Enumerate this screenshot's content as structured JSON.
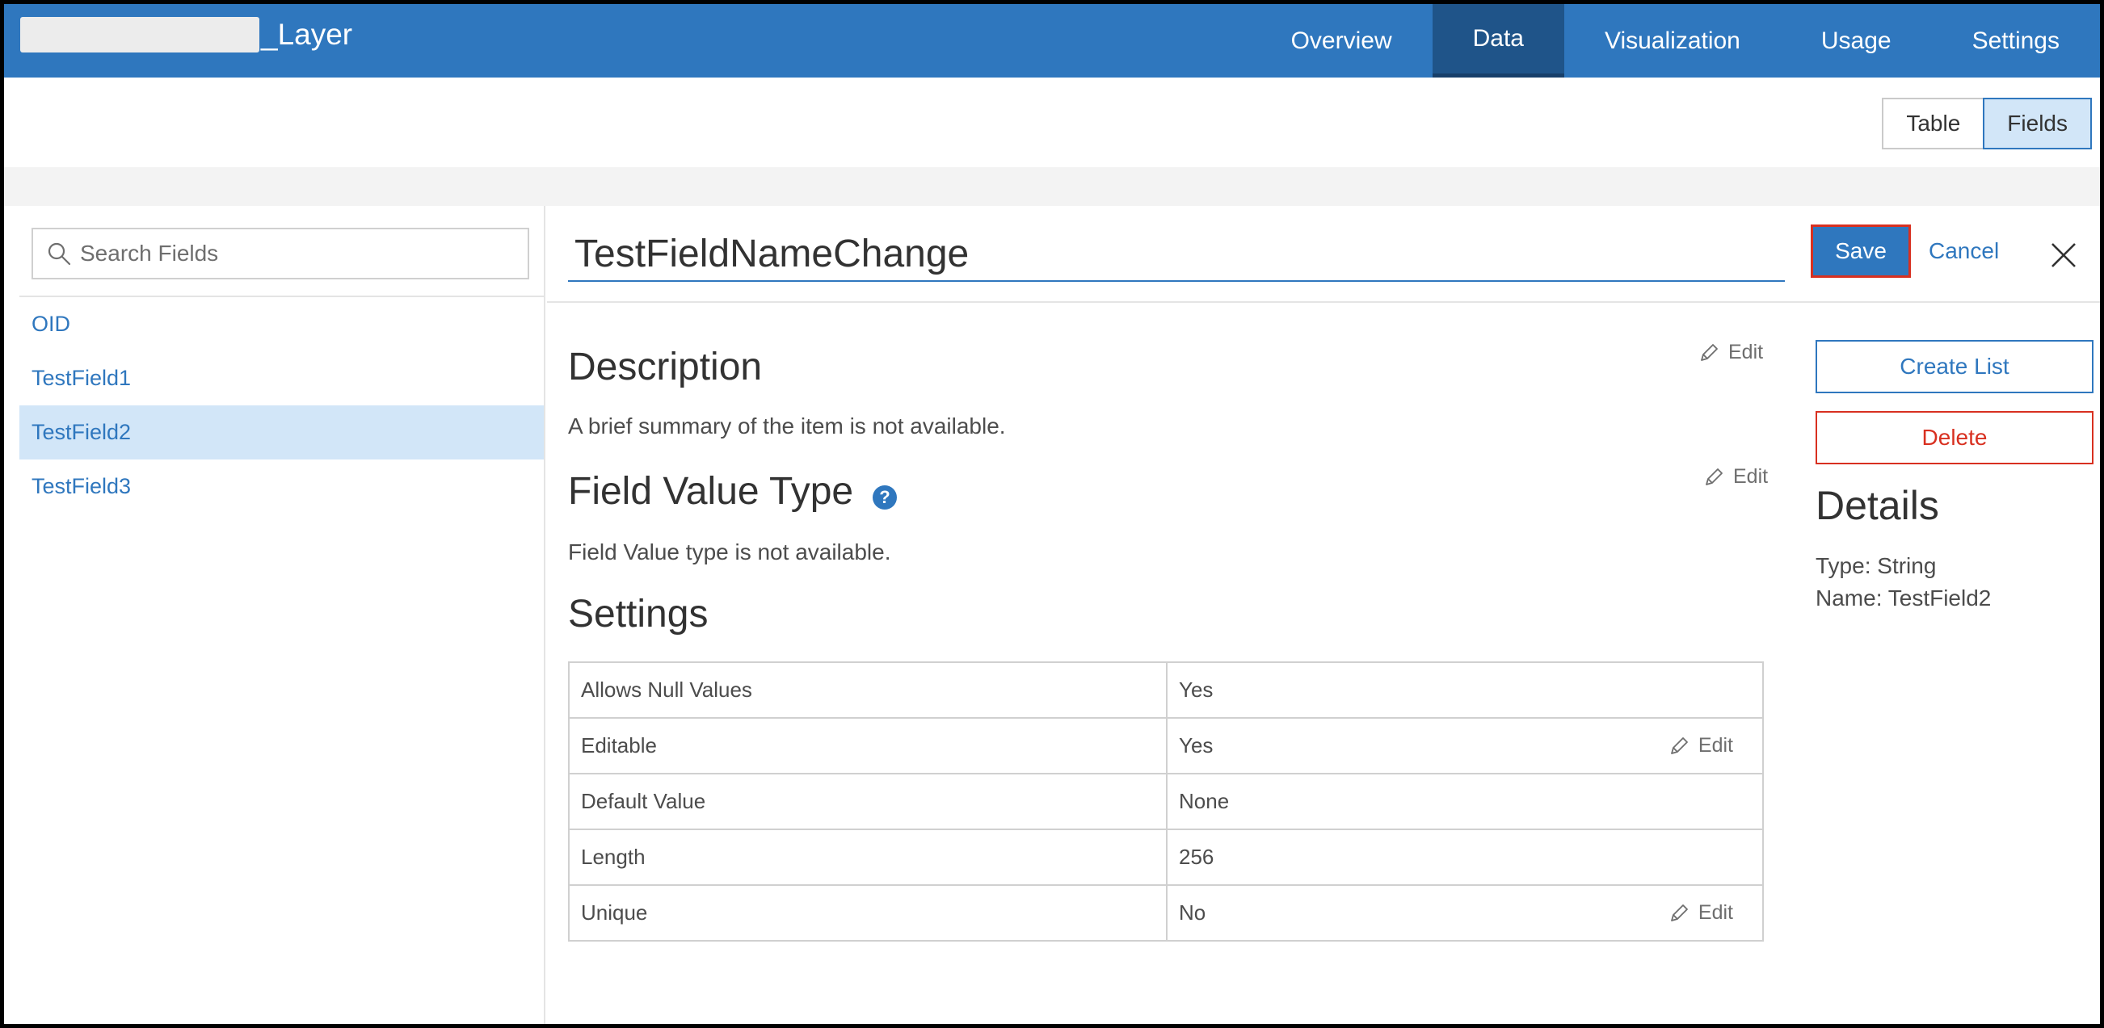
{
  "header": {
    "item_title": "_Layer",
    "tabs": [
      {
        "label": "Overview"
      },
      {
        "label": "Data"
      },
      {
        "label": "Visualization"
      },
      {
        "label": "Usage"
      },
      {
        "label": "Settings"
      }
    ],
    "active_tab": "Data"
  },
  "view_toggle": {
    "table_label": "Table",
    "fields_label": "Fields",
    "active": "Fields"
  },
  "fields_panel": {
    "search_placeholder": "Search Fields",
    "items": [
      {
        "label": "OID"
      },
      {
        "label": "TestField1"
      },
      {
        "label": "TestField2"
      },
      {
        "label": "TestField3"
      }
    ],
    "selected": "TestField2"
  },
  "editor": {
    "name_value": "TestFieldNameChange",
    "save_label": "Save",
    "cancel_label": "Cancel",
    "edit_label": "Edit"
  },
  "description": {
    "heading": "Description",
    "text": "A brief summary of the item is not available."
  },
  "field_value_type": {
    "heading": "Field Value Type",
    "help_glyph": "?",
    "text": "Field Value type is not available."
  },
  "settings": {
    "heading": "Settings",
    "rows": [
      {
        "label": "Allows Null Values",
        "value": "Yes",
        "editable": false
      },
      {
        "label": "Editable",
        "value": "Yes",
        "editable": true
      },
      {
        "label": "Default Value",
        "value": "None",
        "editable": false
      },
      {
        "label": "Length",
        "value": "256",
        "editable": false
      },
      {
        "label": "Unique",
        "value": "No",
        "editable": true
      }
    ]
  },
  "side": {
    "create_list_label": "Create List",
    "delete_label": "Delete",
    "details_heading": "Details",
    "type_line": "Type: String",
    "name_line": "Name: TestField2"
  },
  "colors": {
    "brand_blue": "#2f77be",
    "danger_red": "#d83020",
    "selected_bg": "#d2e6f8"
  },
  "icons": [
    "search-icon",
    "close-icon",
    "pencil-icon",
    "help-icon"
  ]
}
